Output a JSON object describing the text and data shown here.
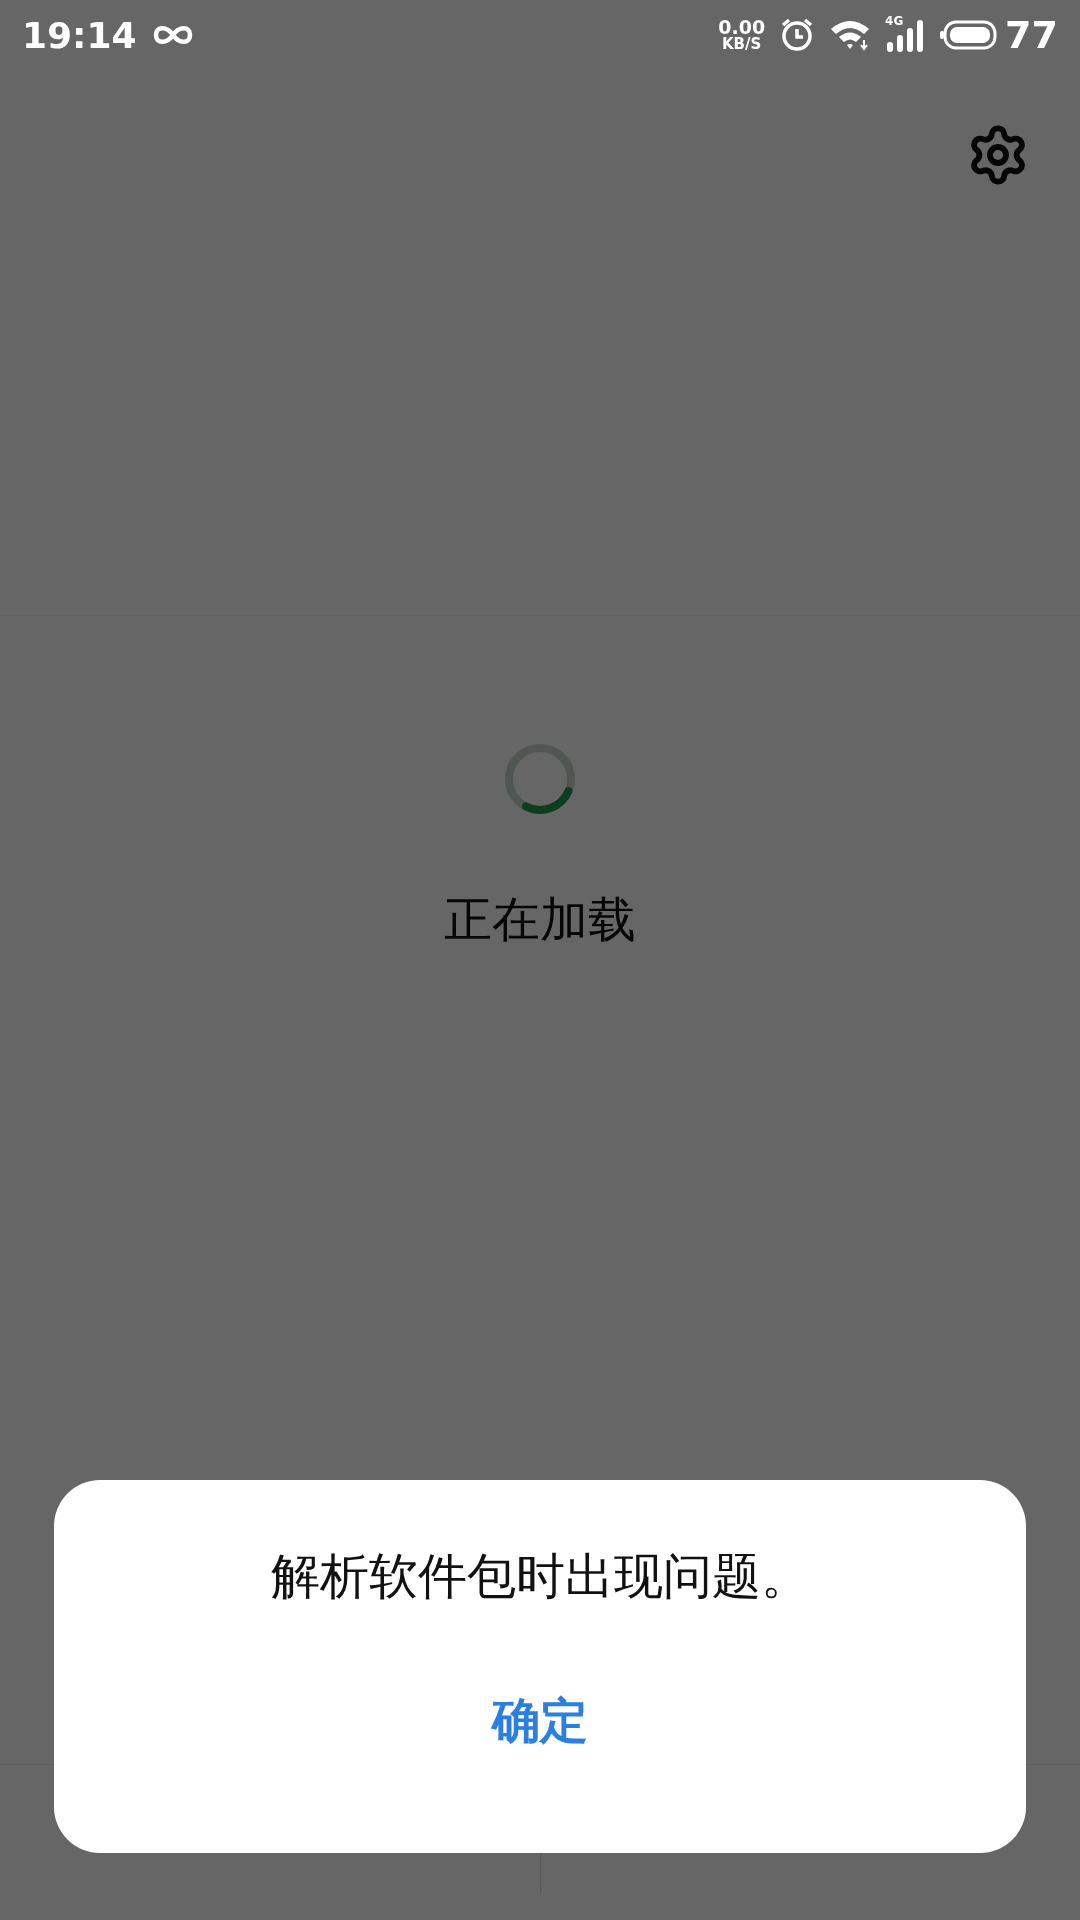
{
  "status_bar": {
    "time": "19:14",
    "net_speed": "0.00",
    "net_unit": "KB/S",
    "network": "4G",
    "battery": "77"
  },
  "loading": {
    "text": "正在加载"
  },
  "dialog": {
    "message": "解析软件包时出现问题。",
    "button": "确定"
  }
}
